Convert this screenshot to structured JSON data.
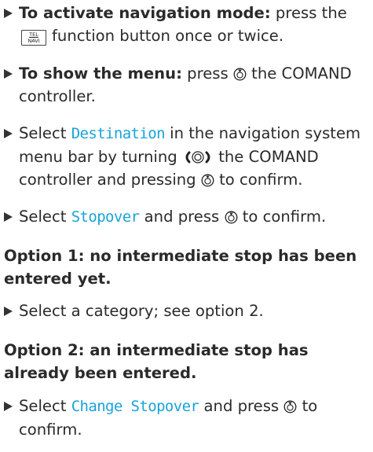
{
  "steps": [
    {
      "lead": "To activate navigation mode:",
      "text_a": "press the",
      "text_b": "function button once or twice."
    },
    {
      "lead": "To show the menu:",
      "text_a": "press",
      "text_b": "the COMAND controller."
    },
    {
      "text_a": "Select",
      "display": "Destination",
      "text_b": "in the navigation system menu bar by turning",
      "text_c": "the COMAND controller and pressing",
      "text_d": "to confirm."
    },
    {
      "text_a": "Select",
      "display": "Stopover",
      "text_b": "and press",
      "text_c": "to confirm."
    },
    {
      "text_a": "Select a category; see option 2."
    },
    {
      "text_a": "Select",
      "display": "Change Stopover",
      "text_b": "and press",
      "text_c": "to confirm."
    }
  ],
  "headings": {
    "option1": "Option 1: no intermediate stop has been entered yet.",
    "option2": "Option 2: an intermediate stop has already been entered."
  },
  "key": {
    "line1": "TEL",
    "line2": "NAVI"
  },
  "icons": {
    "press": "press-controller-icon",
    "turn": "turn-controller-icon",
    "bullet": "step-bullet-triangle"
  },
  "colors": {
    "display_text": "#1aa3d8",
    "body_text": "#2a2a2a"
  }
}
